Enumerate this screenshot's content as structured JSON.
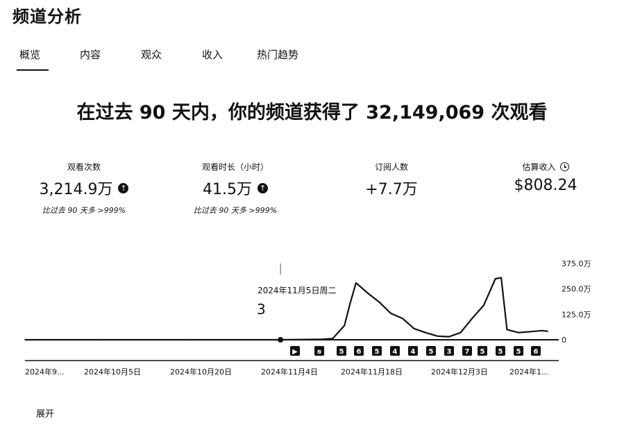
{
  "page": {
    "title": "频道分析"
  },
  "tabs": [
    {
      "label": "概览",
      "active": true
    },
    {
      "label": "内容",
      "active": false
    },
    {
      "label": "观众",
      "active": false
    },
    {
      "label": "收入",
      "active": false
    },
    {
      "label": "热门趋势",
      "active": false
    }
  ],
  "headline": "在过去 90 天内，你的频道获得了 32,149,069 次观看",
  "metrics": [
    {
      "label": "观看次数",
      "value": "3,214.9万",
      "compare": "比过去 90 天多 >999%",
      "icon": "arrow-up-icon"
    },
    {
      "label": "观看时长（小时）",
      "value": "41.5万",
      "compare": "比过去 90 天多 >999%",
      "icon": "arrow-up-icon"
    },
    {
      "label": "订阅人数",
      "value": "+7.7万"
    },
    {
      "label": "估算收入",
      "value": "$808.24",
      "icon": "clock-icon"
    }
  ],
  "tooltip": {
    "date": "2024年11月5日周二",
    "value": "3"
  },
  "chart_data": {
    "type": "line",
    "title": "",
    "xlabel": "",
    "ylabel": "",
    "y_ticks": [
      "375.0万",
      "250.0万",
      "125.0万",
      "0"
    ],
    "ylim": [
      0,
      3750000
    ],
    "x_ticks": [
      "2024年9...",
      "2024年10月5日",
      "2024年10月20日",
      "2024年11月4日",
      "2024年11月18日",
      "2024年12月3日",
      "2024年1..."
    ],
    "x": [
      "2024-09-22",
      "2024-10-05",
      "2024-10-20",
      "2024-11-04",
      "2024-11-05",
      "2024-11-12",
      "2024-11-14",
      "2024-11-16",
      "2024-11-17",
      "2024-11-18",
      "2024-11-20",
      "2024-11-22",
      "2024-11-24",
      "2024-11-26",
      "2024-11-28",
      "2024-11-30",
      "2024-12-02",
      "2024-12-04",
      "2024-12-06",
      "2024-12-08",
      "2024-12-10",
      "2024-12-12",
      "2024-12-13",
      "2024-12-14",
      "2024-12-16",
      "2024-12-18",
      "2024-12-20",
      "2024-12-21"
    ],
    "series": [
      {
        "values": [
          0,
          0,
          0,
          3,
          3,
          20000,
          60000,
          700000,
          1800000,
          2800000,
          2300000,
          1850000,
          1300000,
          1050000,
          550000,
          350000,
          180000,
          150000,
          350000,
          1050000,
          1700000,
          3000000,
          3050000,
          500000,
          350000,
          400000,
          450000,
          420000
        ]
      }
    ],
    "video_markers": [
      "▶",
      "ꞩ",
      "5",
      "6",
      "5",
      "4",
      "4",
      "5",
      "3",
      "7",
      "5",
      "5",
      "5",
      "6"
    ],
    "line_color": "#111111",
    "grid": false
  }
}
